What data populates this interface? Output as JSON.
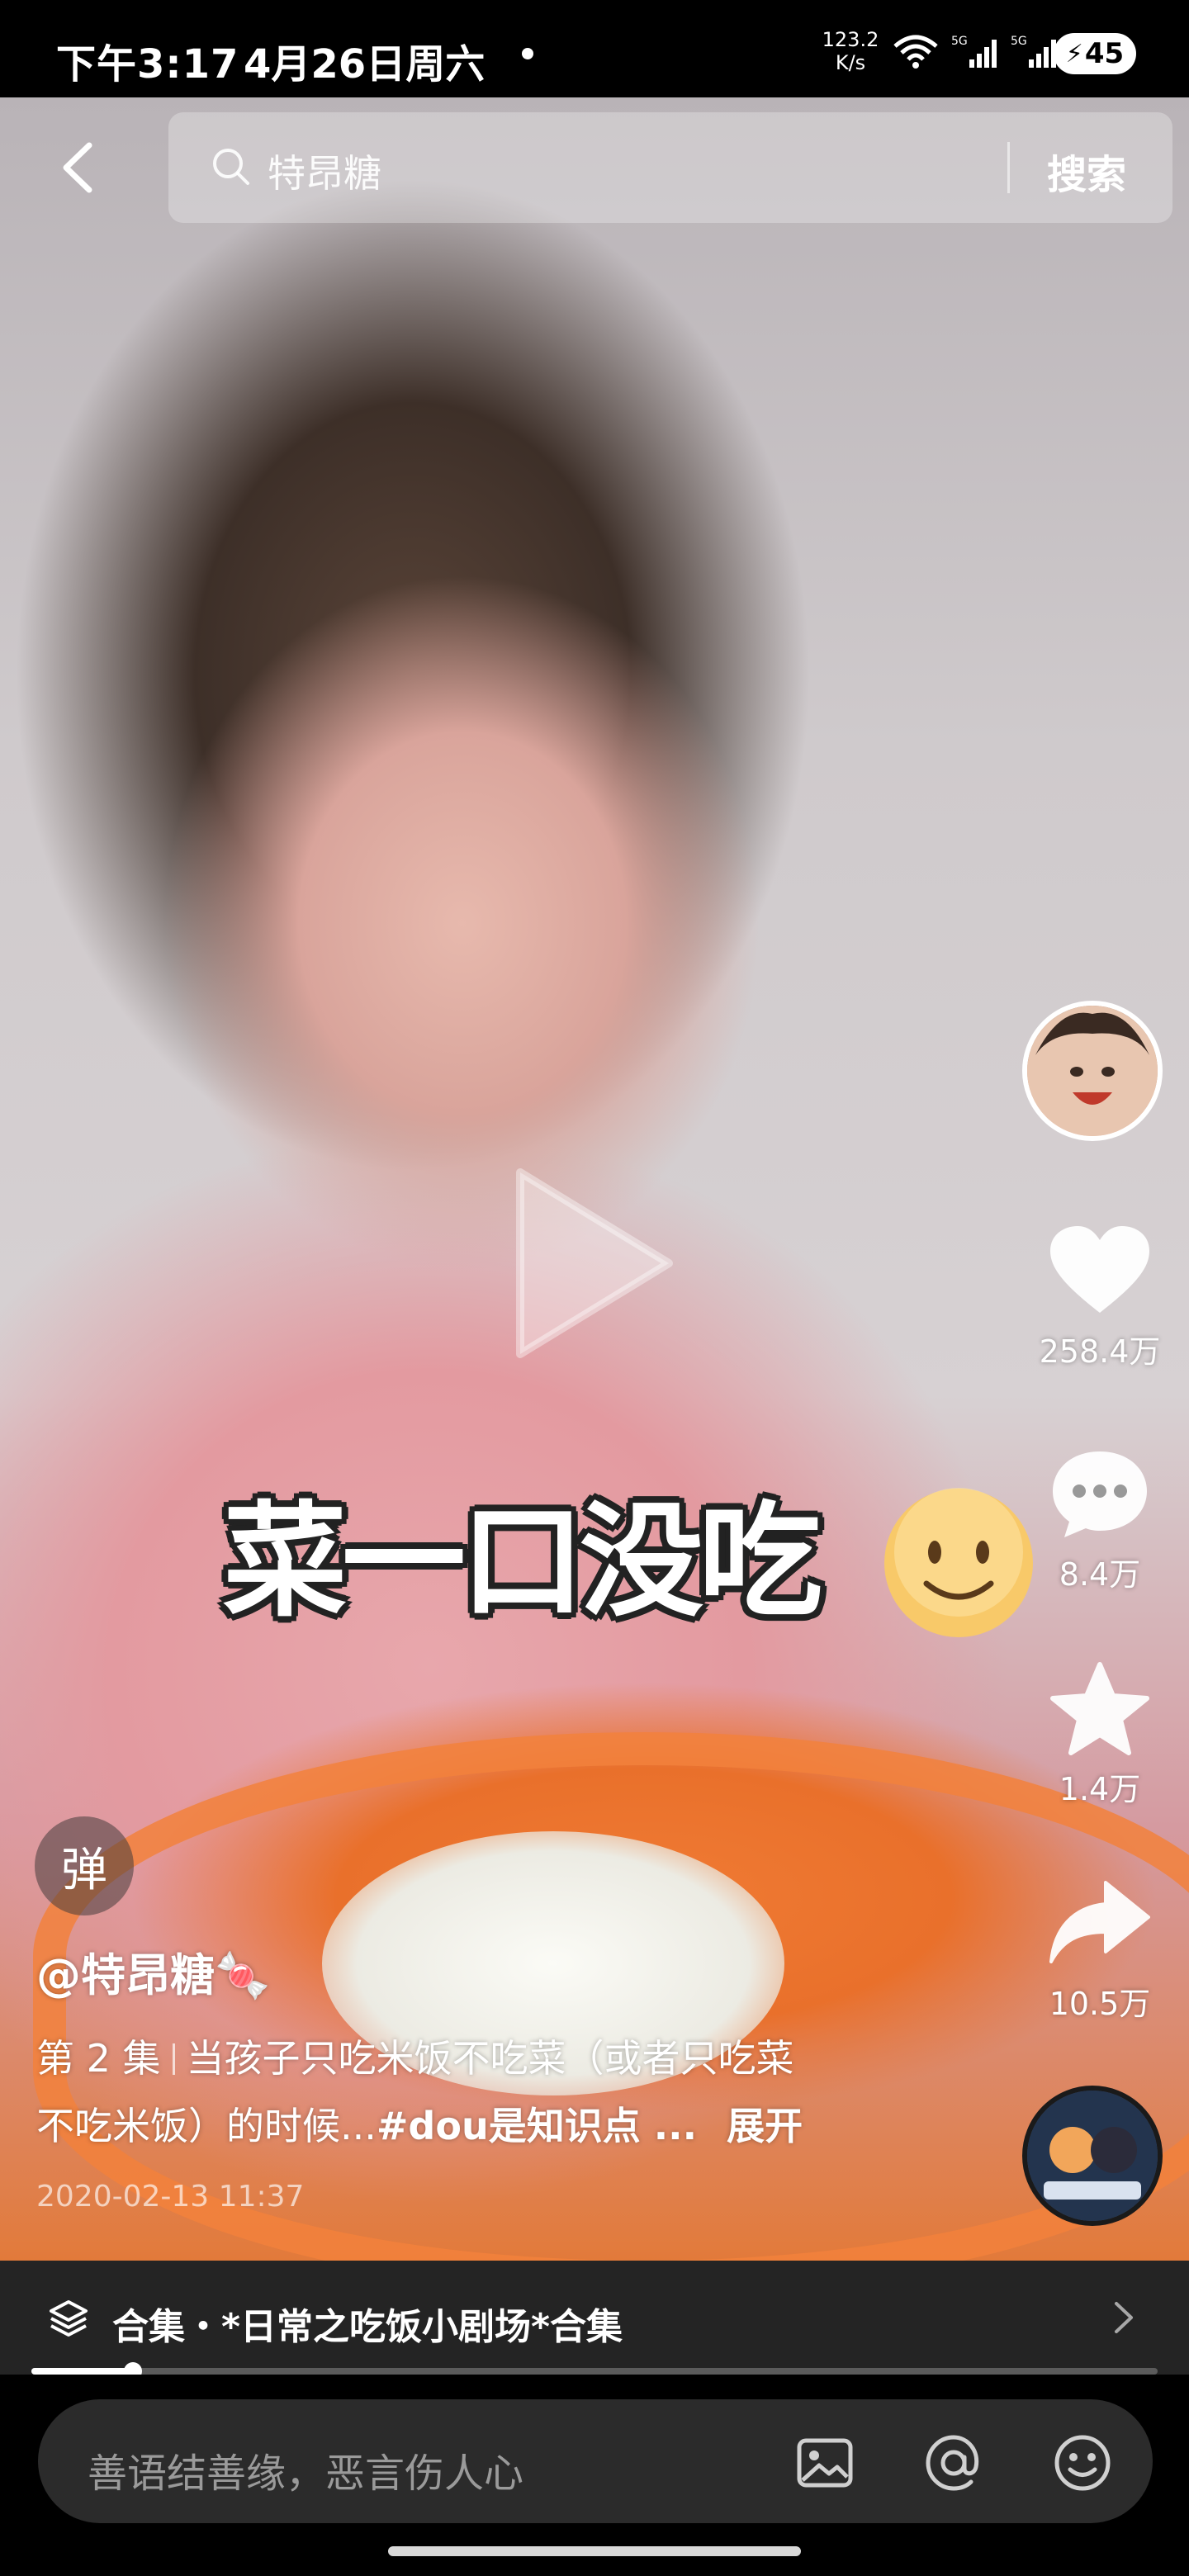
{
  "status_bar": {
    "time": "下午3:17",
    "date": "4月26日周六",
    "net_speed_value": "123.2",
    "net_speed_unit": "K/s",
    "battery": "45"
  },
  "top_bar": {
    "search_query": "特昂糖",
    "search_button": "搜索"
  },
  "video": {
    "overlay_caption": "菜一口没吃",
    "progress": 0.09
  },
  "actions": {
    "like_count": "258.4万",
    "comment_count": "8.4万",
    "favorite_count": "1.4万",
    "share_count": "10.5万"
  },
  "post": {
    "danmu_button": "弹",
    "author": "@特昂糖🍬",
    "episode": "第 2 集",
    "desc_line1": "当孩子只吃米饭不吃菜（或者只吃菜",
    "desc_line2": "不吃米饭）的时候...",
    "hashtag": "#dou是知识点 ...",
    "expand": "展开",
    "timestamp": "2020-02-13 11:37"
  },
  "collection": {
    "label": "合集・*日常之吃饭小剧场*合集"
  },
  "comment_bar": {
    "placeholder": "善语结善缘，恶言伤人心"
  },
  "colors": {
    "plate_orange": "#f07b34",
    "bib_pink": "#e39aa0"
  }
}
